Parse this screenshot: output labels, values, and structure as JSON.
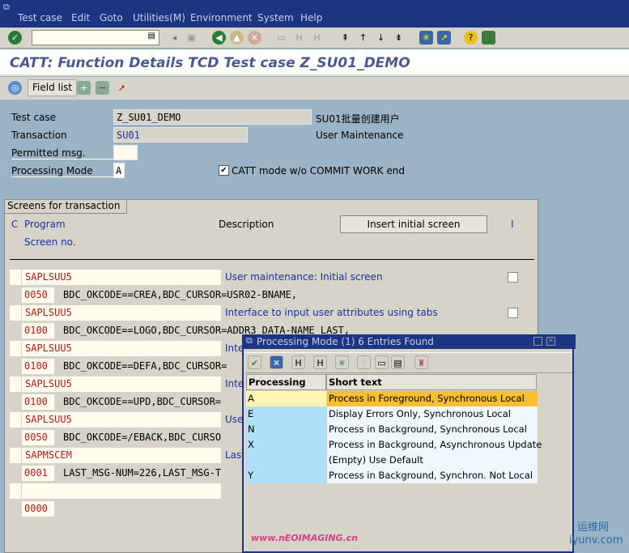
{
  "menu": [
    "Test case",
    "Edit",
    "Goto",
    "Utilities(M)",
    "Environment",
    "System",
    "Help"
  ],
  "page_title": "CATT: Function Details TCD  Test case Z_SU01_DEMO",
  "app_toolbar": {
    "field_list": "Field list"
  },
  "fields": {
    "test_case": {
      "label": "Test case",
      "value": "Z_SU01_DEMO",
      "text": "SU01批量创建用户"
    },
    "transaction": {
      "label": "Transaction",
      "value": "SU01",
      "text": "User Maintenance"
    },
    "permitted_msg": {
      "label": "Permitted msg.",
      "value": ""
    },
    "processing_mode": {
      "label": "Processing Mode",
      "value": "A"
    },
    "catt_mode": {
      "label": "CATT mode w/o COMMIT WORK end",
      "checked": true
    }
  },
  "screens": {
    "group_title": "Screens for transaction",
    "col_c": "C",
    "col_program": "Program",
    "col_screen": "Screen no.",
    "col_desc": "Description",
    "col_i": "I",
    "insert_button": "Insert initial screen",
    "rows": [
      {
        "program": "SAPLSUU5",
        "screen": "0050",
        "bdc": "BDC_OKCODE==CREA,BDC_CURSOR=USR02-BNAME,",
        "desc": "User maintenance: Initial screen"
      },
      {
        "program": "SAPLSUU5",
        "screen": "0100",
        "bdc": "BDC_OKCODE==LOGO,BDC_CURSOR=ADDR3_DATA-NAME_LAST,",
        "desc": "Interface to input user attributes using tabs"
      },
      {
        "program": "SAPLSUU5",
        "screen": "0100",
        "bdc": "BDC_OKCODE==DEFA,BDC_CURSOR=",
        "desc": "Inte"
      },
      {
        "program": "SAPLSUU5",
        "screen": "0100",
        "bdc": "BDC_OKCODE==UPD,BDC_CURSOR=",
        "desc": "Inte"
      },
      {
        "program": "SAPLSUU5",
        "screen": "0050",
        "bdc": "BDC_OKCODE=/EBACK,BDC_CURSO",
        "desc": "Use"
      },
      {
        "program": "SAPMSCEM",
        "screen": "0001",
        "bdc": "LAST_MSG-NUM=226,LAST_MSG-T",
        "desc": "Last"
      },
      {
        "program": "",
        "screen": "0000",
        "bdc": "",
        "desc": ""
      }
    ]
  },
  "popup": {
    "title": "Processing Mode (1)    6 Entries Found",
    "col1": "Processing Mo...",
    "col2": "Short text",
    "rows": [
      {
        "key": "A",
        "text": "Process in Foreground, Synchronous Local"
      },
      {
        "key": "E",
        "text": "Display Errors Only, Synchronous Local"
      },
      {
        "key": "N",
        "text": "Process in Background, Synchronous Local"
      },
      {
        "key": "X",
        "text": "Process in Background, Asynchronous Update"
      },
      {
        "key": "",
        "text": "(Empty) Use Default"
      },
      {
        "key": "Y",
        "text": "Process in Background, Synchron. Not Local"
      }
    ]
  },
  "watermarks": [
    "www.nEOIMAGING.cn",
    "运维网",
    "iyunv.com"
  ]
}
